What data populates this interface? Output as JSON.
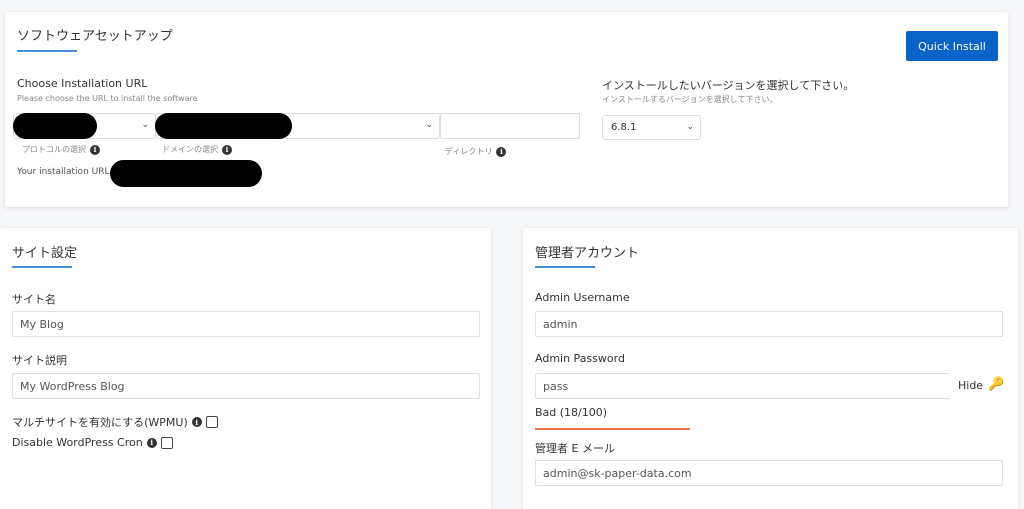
{
  "software": {
    "title": "ソフトウェアセットアップ",
    "quick_install": "Quick Install",
    "choose_url_label": "Choose Installation URL",
    "choose_url_sub": "Please choose the URL to install the software",
    "protocol_hint": "プロトコルの選択",
    "domain_hint": "ドメインの選択",
    "directory_hint": "ディレクトリ",
    "directory_value": "",
    "your_url_label": "Your installation URL",
    "version_label": "インストールしたいバージョンを選択して下さい。",
    "version_sub": "インストールするバージョンを選択して下さい。",
    "version_value": "6.8.1"
  },
  "site": {
    "title": "サイト設定",
    "site_name_label": "サイト名",
    "site_name_value": "My Blog",
    "site_desc_label": "サイト説明",
    "site_desc_value": "My WordPress Blog",
    "multisite_label": "マルチサイトを有効にする(WPMU)",
    "cron_label": "Disable WordPress Cron"
  },
  "admin": {
    "title": "管理者アカウント",
    "username_label": "Admin Username",
    "username_value": "admin",
    "password_label": "Admin Password",
    "password_value": "pass",
    "hide_label": "Hide",
    "strength_text": "Bad (18/100)",
    "strength_percent": 18,
    "email_label": "管理者 E メール",
    "email_value": "admin@sk-paper-data.com"
  },
  "colors": {
    "accent": "#0a63c9",
    "underline": "#4b8ed8",
    "strength_bad": "#e8764a"
  }
}
